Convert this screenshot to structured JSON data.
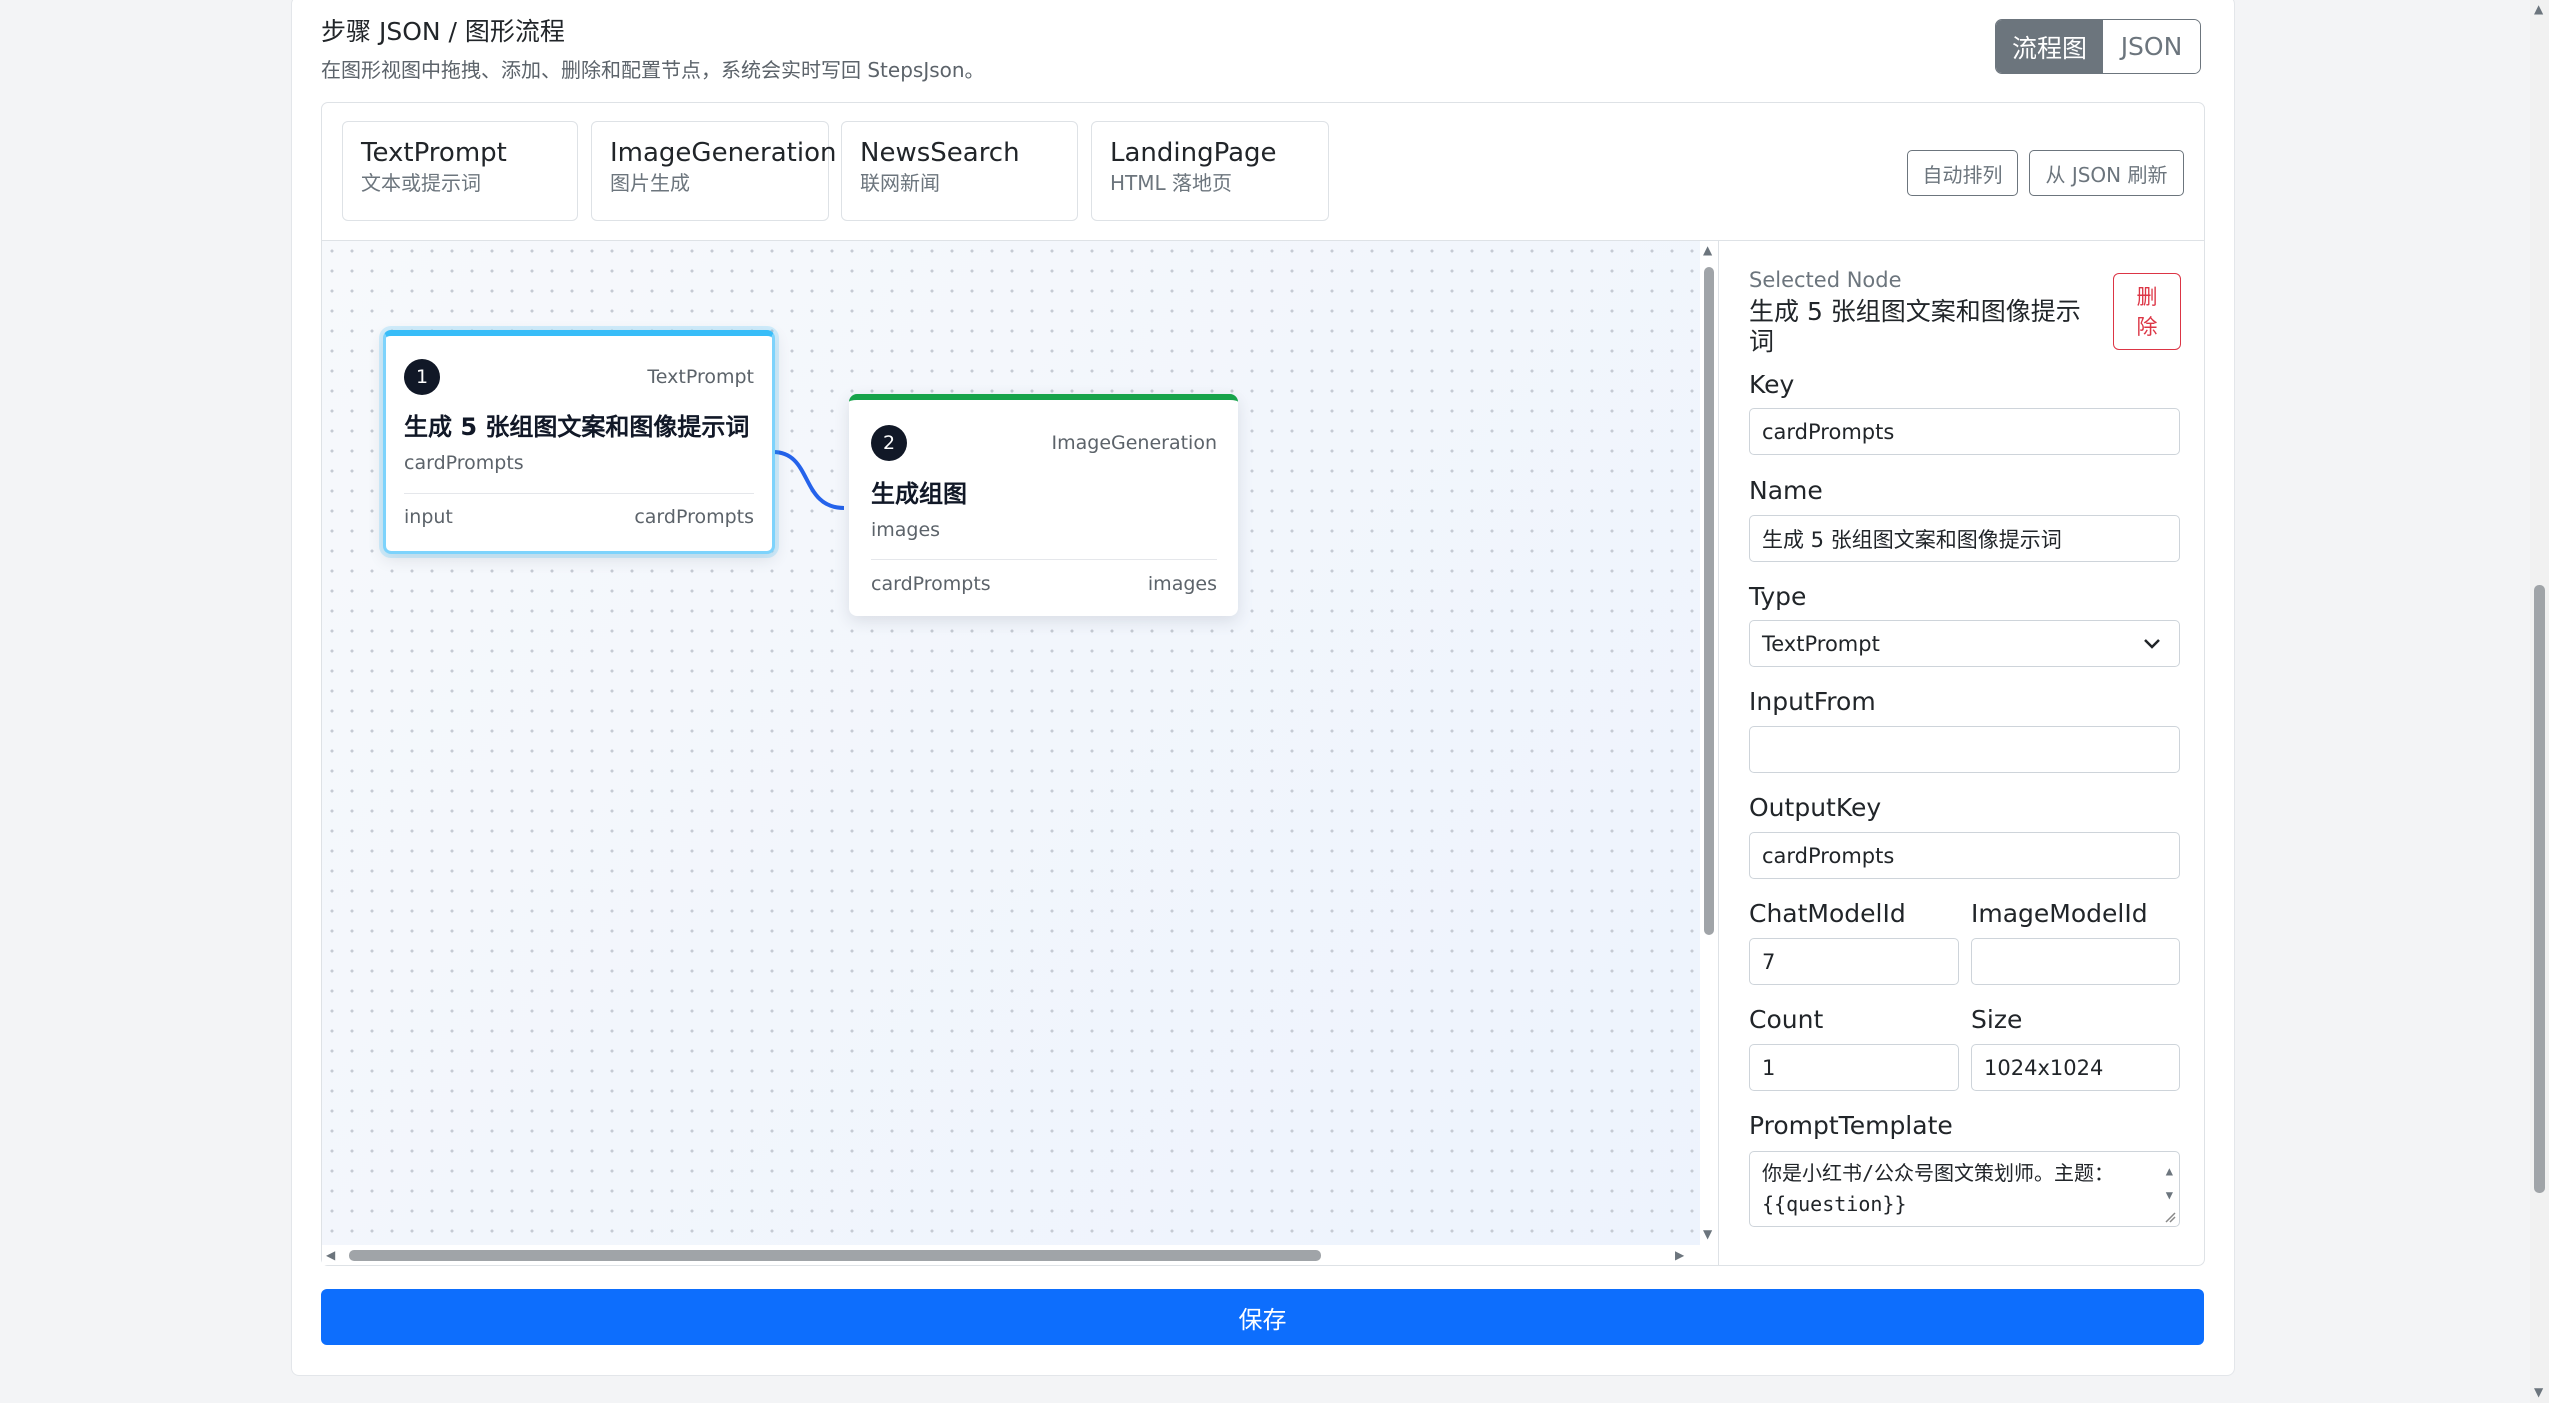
{
  "header": {
    "title": "步骤 JSON / 图形流程",
    "subtitle": "在图形视图中拖拽、添加、删除和配置节点，系统会实时写回 StepsJson。"
  },
  "view_toggle": {
    "flow_label": "流程图",
    "json_label": "JSON",
    "active": "flow"
  },
  "palette": [
    {
      "title": "TextPrompt",
      "desc": "文本或提示词"
    },
    {
      "title": "ImageGeneration",
      "desc": "图片生成"
    },
    {
      "title": "NewsSearch",
      "desc": "联网新闻"
    },
    {
      "title": "LandingPage",
      "desc": "HTML 落地页"
    }
  ],
  "toolbar": {
    "auto_layout": "自动排列",
    "refresh_from_json": "从 JSON 刷新"
  },
  "nodes": [
    {
      "index": "1",
      "type": "TextPrompt",
      "name": "生成 5 张组图文案和图像提示词",
      "key": "cardPrompts",
      "input": "input",
      "output": "cardPrompts",
      "accent": "#38bdf8",
      "selected": true
    },
    {
      "index": "2",
      "type": "ImageGeneration",
      "name": "生成组图",
      "key": "images",
      "input": "cardPrompts",
      "output": "images",
      "accent": "#16a34a",
      "selected": false
    }
  ],
  "selected_node": {
    "caption": "Selected Node",
    "name": "生成 5 张组图文案和图像提示词",
    "delete_label": "删除",
    "fields": {
      "key_label": "Key",
      "key_value": "cardPrompts",
      "name_label": "Name",
      "name_value": "生成 5 张组图文案和图像提示词",
      "type_label": "Type",
      "type_value": "TextPrompt",
      "inputfrom_label": "InputFrom",
      "inputfrom_value": "",
      "outputkey_label": "OutputKey",
      "outputkey_value": "cardPrompts",
      "chatmodel_label": "ChatModelId",
      "chatmodel_value": "7",
      "imagemodel_label": "ImageModelId",
      "imagemodel_value": "",
      "count_label": "Count",
      "count_value": "1",
      "size_label": "Size",
      "size_value": "1024x1024",
      "prompt_label": "PromptTemplate",
      "prompt_line1": "你是小红书/公众号图文策划师。主题：",
      "prompt_line2": "{{question}}"
    }
  },
  "save_label": "保存",
  "colors": {
    "primary": "#0d6efd",
    "danger": "#dc3545",
    "secondary": "#6c757d",
    "edge": "#2563eb"
  }
}
